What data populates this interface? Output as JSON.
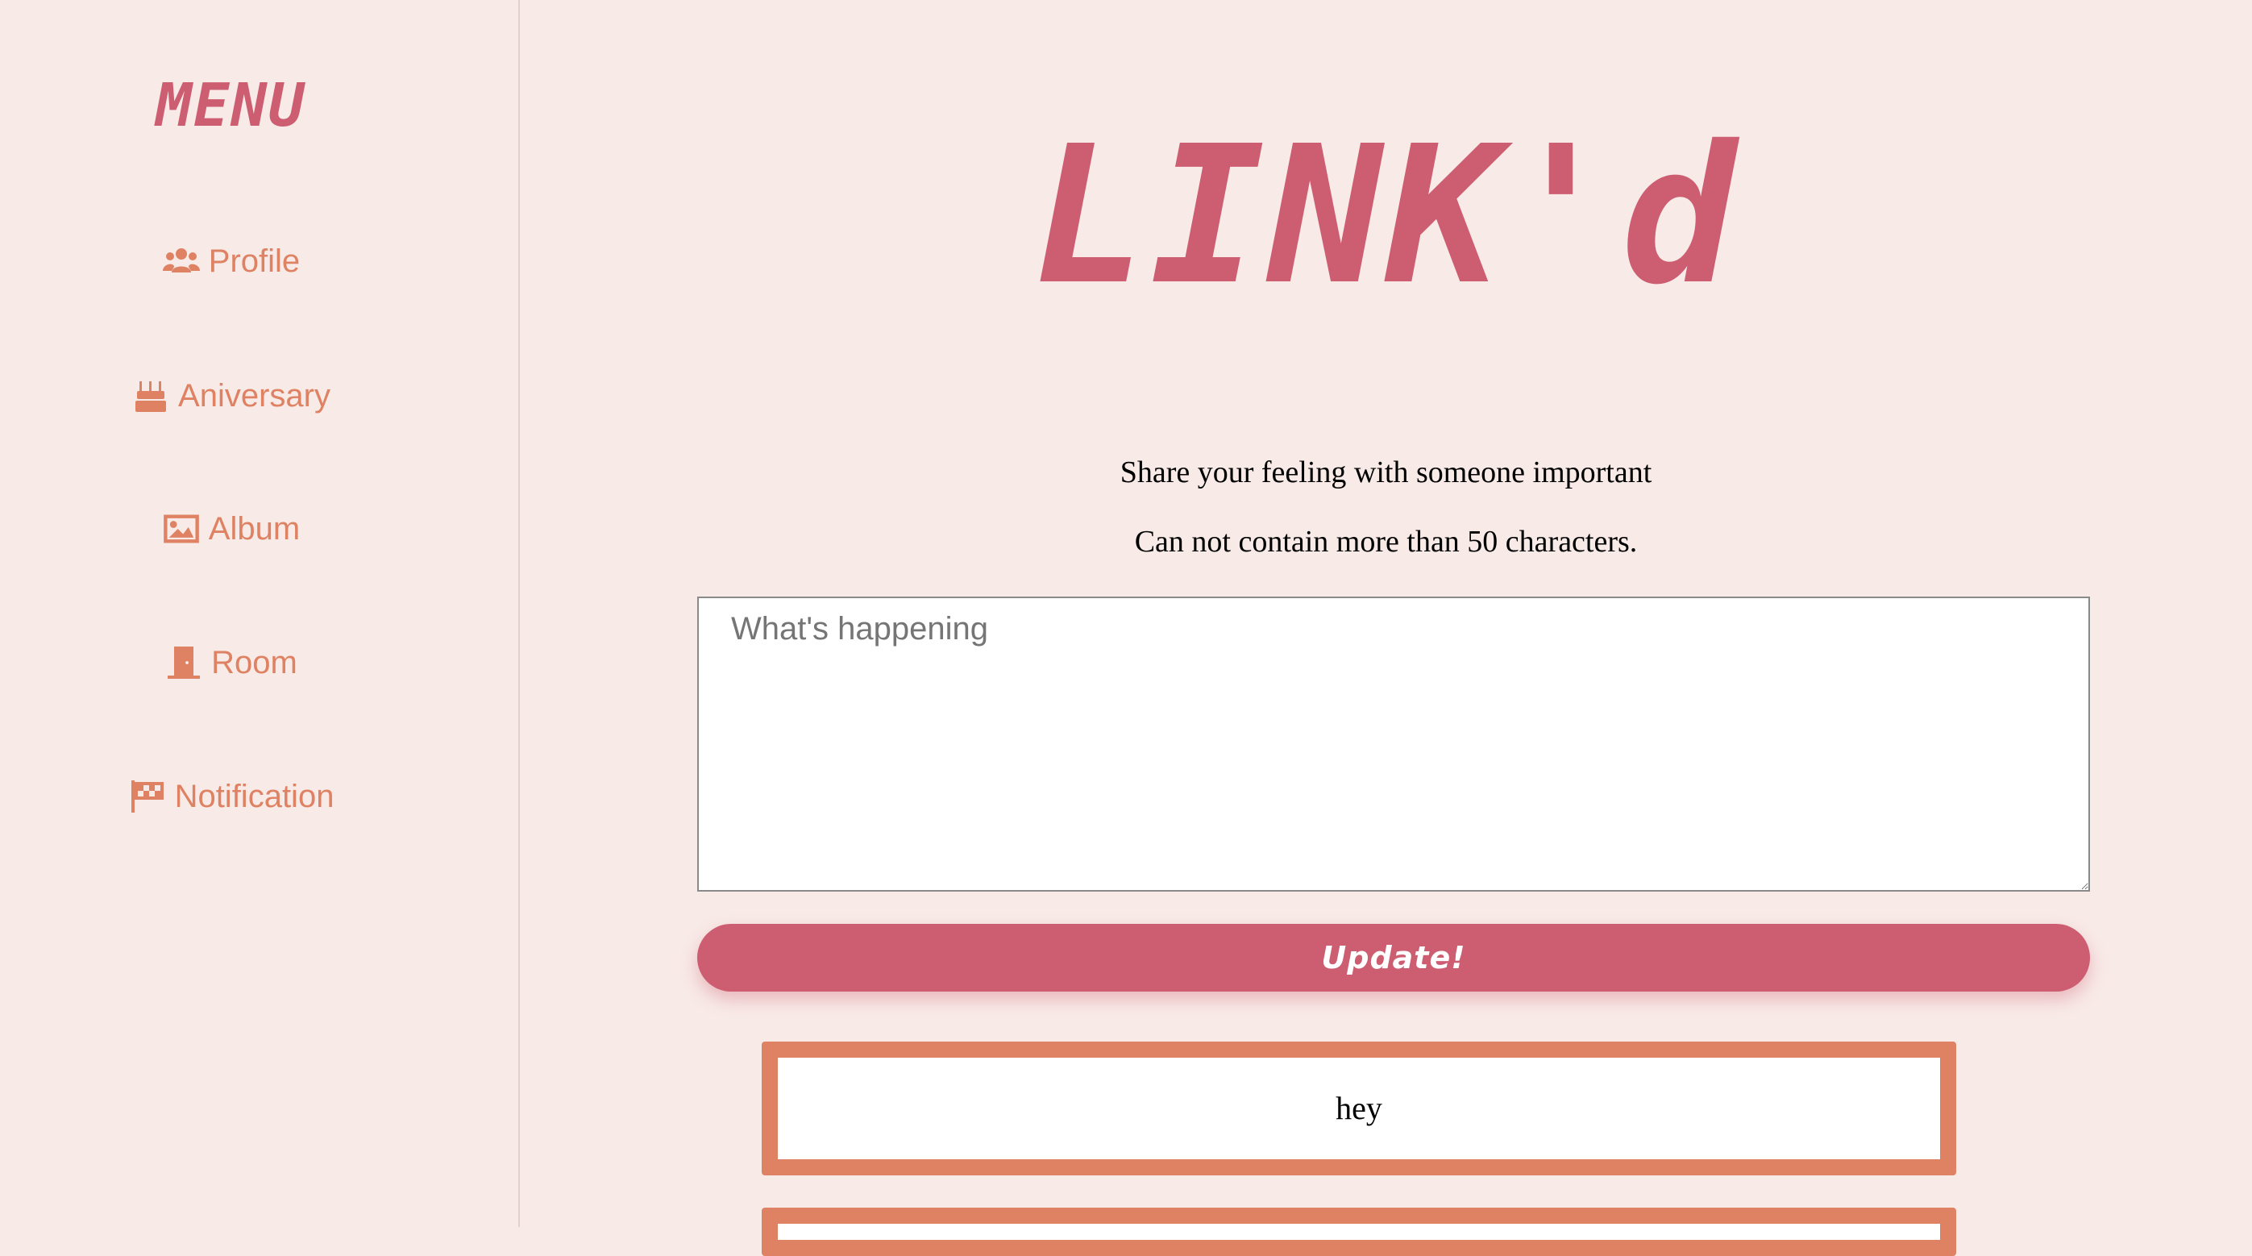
{
  "sidebar": {
    "title": "MENU",
    "items": [
      {
        "label": "Profile",
        "icon": "users-icon"
      },
      {
        "label": "Aniversary",
        "icon": "birthday-cake-icon"
      },
      {
        "label": "Album",
        "icon": "image-icon"
      },
      {
        "label": "Room",
        "icon": "door-icon"
      },
      {
        "label": "Notification",
        "icon": "checkered-flag-icon"
      }
    ]
  },
  "main": {
    "logo": "LINK'd",
    "prompt_line1": "Share your feeling with someone important",
    "prompt_line2": "Can not contain more than 50 characters.",
    "status_input": {
      "placeholder": "What's happening",
      "value": ""
    },
    "update_label": "Update!",
    "posts": [
      {
        "text": "hey"
      },
      {
        "text": ""
      }
    ]
  },
  "colors": {
    "background": "#f8eae7",
    "brand_pink": "#cd5d71",
    "accent_orange": "#de8263"
  }
}
